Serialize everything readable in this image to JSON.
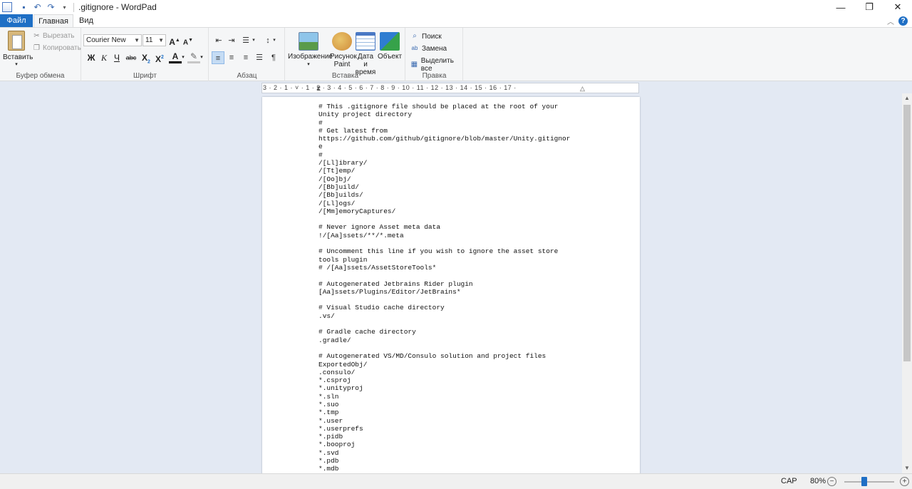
{
  "window": {
    "title": ".gitignore - WordPad"
  },
  "tabs": {
    "file": "Файл",
    "home": "Главная",
    "view": "Вид"
  },
  "clipboard": {
    "paste": "Вставить",
    "cut": "Вырезать",
    "copy": "Копировать",
    "label": "Буфер обмена"
  },
  "font": {
    "family": "Courier New",
    "size": "11",
    "bold": "Ж",
    "italic": "К",
    "underline": "Ч",
    "strike": "abc",
    "label": "Шрифт"
  },
  "paragraph": {
    "label": "Абзац"
  },
  "insert": {
    "image": "Изображение",
    "paint_line1": "Рисунок",
    "paint_line2": "Paint",
    "datetime_line1": "Дата и",
    "datetime_line2": "время",
    "object": "Объект",
    "label": "Вставка"
  },
  "editing": {
    "find": "Поиск",
    "replace": "Замена",
    "select_all": "Выделить все",
    "label": "Правка"
  },
  "ruler": {
    "marks": "3 · 2 · 1 · ˅ · 1 · 2 · 3 · 4 · 5 · 6 · 7 · 8 · 9 · 10 · 11 · 12 · 13 · 14 · 15 · 16 · 17 ·"
  },
  "document": {
    "lines": [
      "# This .gitignore file should be placed at the root of your",
      "Unity project directory",
      "#",
      "# Get latest from",
      "https://github.com/github/gitignore/blob/master/Unity.gitignor",
      "e",
      "#",
      "/[Ll]ibrary/",
      "/[Tt]emp/",
      "/[Oo]bj/",
      "/[Bb]uild/",
      "/[Bb]uilds/",
      "/[Ll]ogs/",
      "/[Mm]emoryCaptures/",
      "",
      "# Never ignore Asset meta data",
      "!/[Aa]ssets/**/*.meta",
      "",
      "# Uncomment this line if you wish to ignore the asset store",
      "tools plugin",
      "# /[Aa]ssets/AssetStoreTools*",
      "",
      "# Autogenerated Jetbrains Rider plugin",
      "[Aa]ssets/Plugins/Editor/JetBrains*",
      "",
      "# Visual Studio cache directory",
      ".vs/",
      "",
      "# Gradle cache directory",
      ".gradle/",
      "",
      "# Autogenerated VS/MD/Consulo solution and project files",
      "ExportedObj/",
      ".consulo/",
      "*.csproj",
      "*.unityproj",
      "*.sln",
      "*.suo",
      "*.tmp",
      "*.user",
      "*.userprefs",
      "*.pidb",
      "*.booproj",
      "*.svd",
      "*.pdb",
      "*.mdb"
    ]
  },
  "status": {
    "caps": "CAP",
    "zoom": "80%",
    "zoom_level": 0.8
  }
}
